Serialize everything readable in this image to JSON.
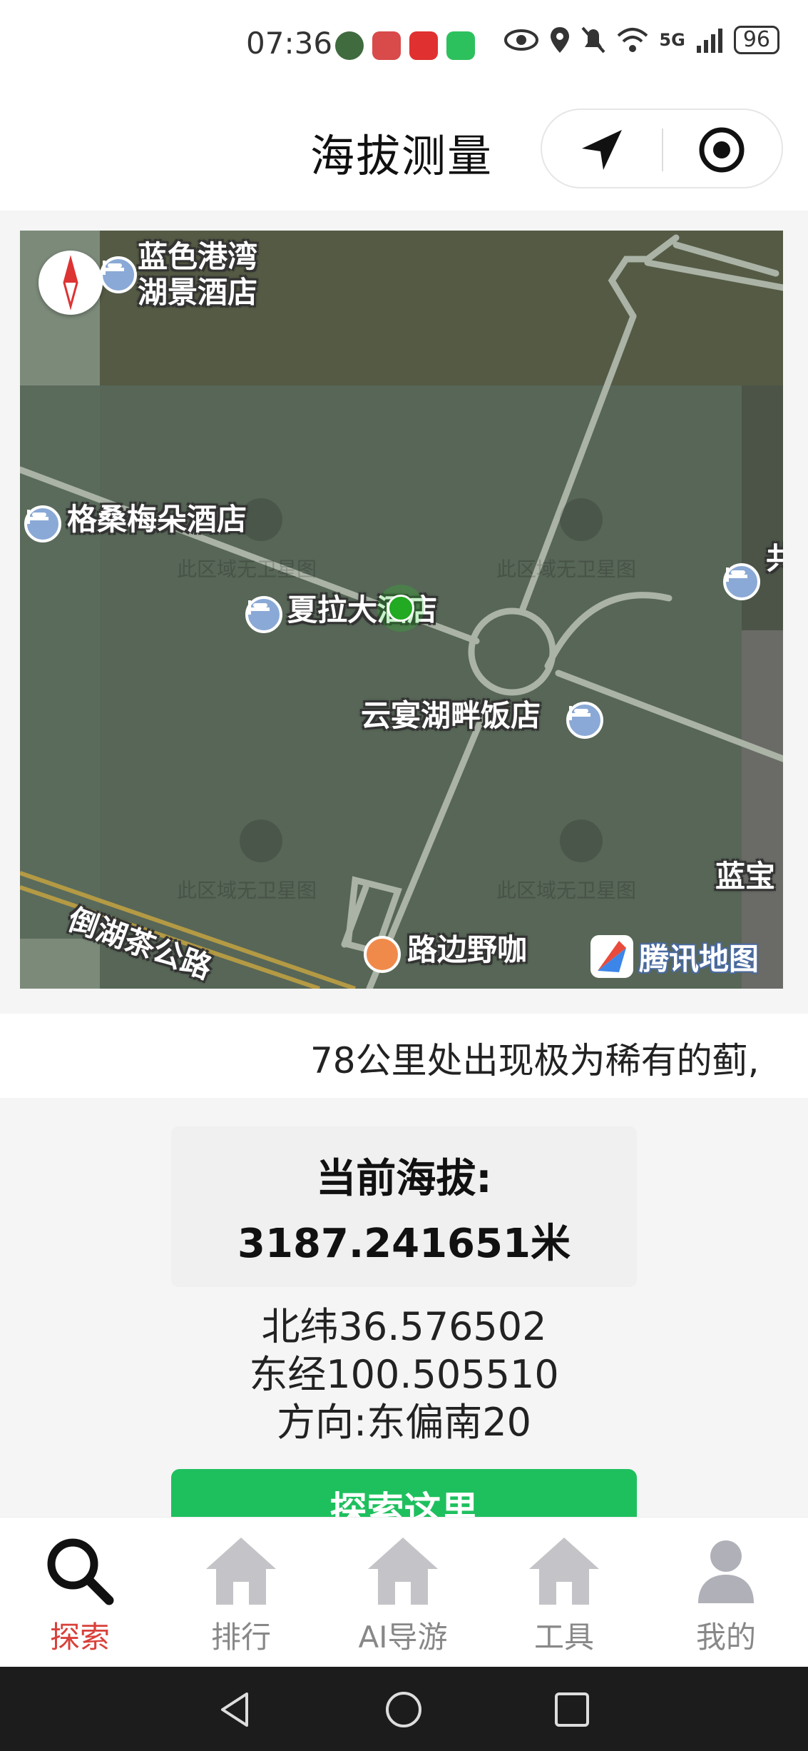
{
  "status_bar": {
    "time": "07:36",
    "network": "5G",
    "battery": "96",
    "icons": [
      "eye-icon",
      "location-icon",
      "mute-icon",
      "wifi-icon",
      "signal-icon"
    ]
  },
  "header": {
    "title": "海拔测量",
    "capsule_buttons": [
      "navigation-arrow-icon",
      "target-icon"
    ]
  },
  "map": {
    "labels": {
      "hotel_1": "蓝色港湾\n湖景酒店",
      "hotel_2": "格桑梅朵酒店",
      "hotel_3": "夏拉大酒店",
      "restaurant": "云宴湖畔饭店",
      "road": "倒湖茶公路",
      "cafe": "路边野咖",
      "edge_right_top": "共",
      "edge_right_bottom": "蓝宝"
    },
    "watermark": "此区域无卫星图",
    "provider": "腾讯地图"
  },
  "marquee": {
    "text": "78公里处出现极为稀有的蓟,"
  },
  "altitude": {
    "label": "当前海拔:",
    "value": "3187.241651米"
  },
  "coords": {
    "latitude": "北纬36.576502",
    "longitude": "东经100.505510",
    "direction": "方向:东偏南20"
  },
  "action": {
    "explore_label": "探索这里"
  },
  "tabbar": {
    "tabs": [
      {
        "label": "探索",
        "icon": "search-icon",
        "active": true
      },
      {
        "label": "排行",
        "icon": "home-icon",
        "active": false
      },
      {
        "label": "AI导游",
        "icon": "home-icon",
        "active": false
      },
      {
        "label": "工具",
        "icon": "home-icon",
        "active": false
      },
      {
        "label": "我的",
        "icon": "user-icon",
        "active": false
      }
    ]
  },
  "colors": {
    "accent_green": "#1ec05e",
    "active_tab": "#d9403a",
    "inactive_tab": "#888888",
    "map_overlay": "#5a6b5c"
  }
}
